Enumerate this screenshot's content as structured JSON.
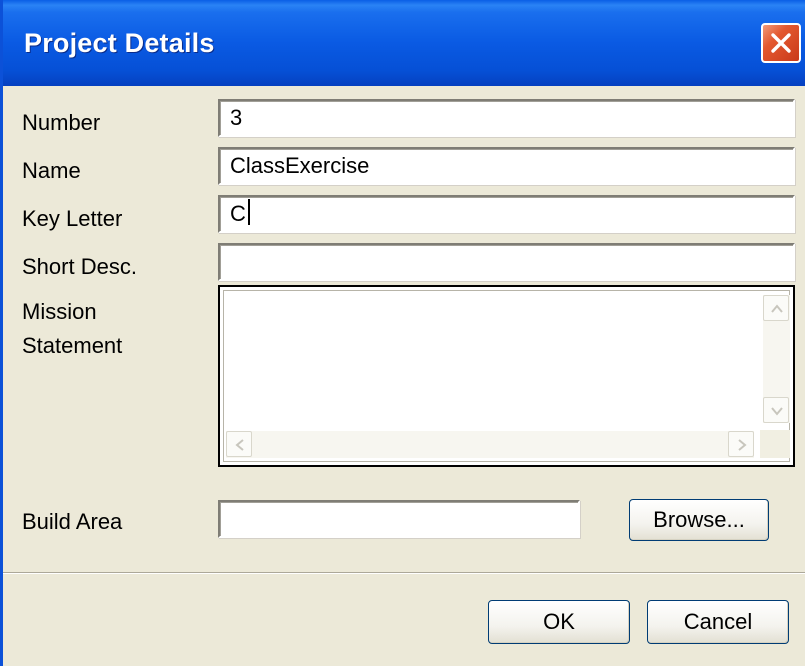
{
  "window": {
    "title": "Project Details"
  },
  "form": {
    "number": {
      "label": "Number",
      "value": "3"
    },
    "name": {
      "label": "Name",
      "value": "ClassExercise"
    },
    "key_letter": {
      "label": "Key Letter",
      "value": "C"
    },
    "short_desc": {
      "label": "Short Desc.",
      "value": ""
    },
    "mission": {
      "label_line1": "Mission",
      "label_line2": "Statement",
      "value": ""
    },
    "build_area": {
      "label": "Build Area",
      "value": ""
    }
  },
  "buttons": {
    "browse": "Browse...",
    "ok": "OK",
    "cancel": "Cancel"
  },
  "icons": {
    "close": "close-icon",
    "scroll_up": "arrow-up-icon",
    "scroll_down": "arrow-down-icon",
    "scroll_left": "arrow-left-icon",
    "scroll_right": "arrow-right-icon"
  },
  "colors": {
    "titlebar": "#0a5ae3",
    "close_button": "#e3582f",
    "dialog_background": "#ece9d8"
  }
}
